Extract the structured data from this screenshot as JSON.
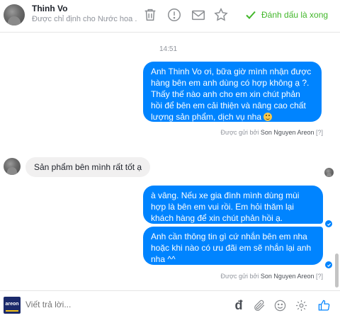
{
  "header": {
    "contact_name": "Thinh Vo",
    "contact_subtitle": "Được chỉ định cho Nước hoa ...",
    "icons": [
      "trash-icon",
      "alert-icon",
      "mail-icon",
      "star-icon"
    ],
    "done_label": "Đánh dấu là xong"
  },
  "thread": {
    "timestamp": "14:51",
    "messages": [
      {
        "direction": "outgoing",
        "text": "Anh Thinh Vo ơi, bữa giờ mình nhận được hàng bên em anh dùng có hợp không ạ ?. Thấy thế nào anh cho em xin chút phản hồi để bên em cải thiện và nâng cao chất lượng sản phẩm, dịch vụ nha"
      },
      {
        "direction": "incoming",
        "text": "Sản phẩm bên mình rất tốt ạ"
      },
      {
        "direction": "outgoing",
        "text": "à vâng. Nếu xe gia đình mình dùng mùi hợp là bên em vui rồi. Em hỏi thăm lại khách hàng để xin chút phản hồi ạ."
      },
      {
        "direction": "outgoing",
        "text": "Anh cần thông tin gì cứ nhắn bên em nha hoặc khi nào có ưu đãi em sẽ nhắn lại anh nha ^^"
      }
    ],
    "sent_by_1": {
      "prefix": "Được gửi bởi ",
      "sender": "Son Nguyen Areon",
      "suffix": " [?]"
    },
    "sent_by_2": {
      "prefix": "Được gửi bởi ",
      "sender": "Son Nguyen Areon",
      "suffix": " [?]"
    }
  },
  "composer": {
    "brand_text": "areon",
    "placeholder": "Viết trả lời...",
    "currency_symbol": "đ",
    "icons": [
      "currency-icon",
      "attach-icon",
      "emoji-icon",
      "settings-icon",
      "like-icon"
    ]
  },
  "colors": {
    "accent": "#0084ff",
    "done_green": "#42b72a",
    "incoming_bubble": "#f1f0f0",
    "muted_text": "#90949c"
  }
}
